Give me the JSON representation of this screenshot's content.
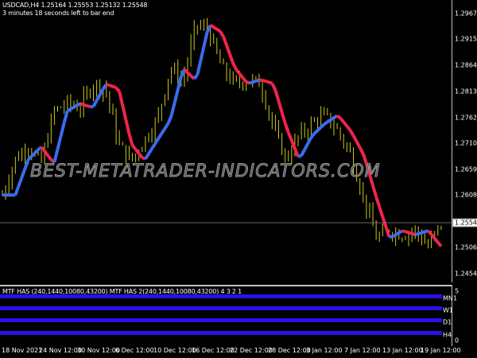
{
  "header": {
    "symbol_line": "USDCAD,H4  1.25164 1.25553 1.25132 1.25548",
    "timer": "3 minutes 18 seconds left to bar end"
  },
  "price_axis": [
    "1.29670",
    "1.29150",
    "1.28640",
    "1.28130",
    "1.27620",
    "1.27100",
    "1.26590",
    "1.26080",
    "1.25060",
    "1.24540"
  ],
  "current_price": "1.25548",
  "watermark": "BEST-METATRADER-INDICATORS.COM",
  "indicator": {
    "title": "MTF HAS (240,1440,10080,43200)  MTF HAS 2(240,1440,10080,43200) 4 3 2 1",
    "scale_max": "5",
    "scale_min": "0",
    "timeframes": [
      "MN1",
      "W1",
      "D1",
      "H4"
    ],
    "bar_color": "#2a10e8"
  },
  "date_axis": [
    "18 Nov 2021",
    "24 Nov 12:00",
    "30 Nov 12:00",
    "6 Dec 12:00",
    "10 Dec 12:00",
    "16 Dec 12:00",
    "22 Dec 12:00",
    "28 Dec 12:00",
    "3 Jan 12:00",
    "7 Jan 12:00",
    "13 Jan 12:00",
    "19 Jan 12:00"
  ],
  "colors": {
    "bars": "#c8c81a",
    "has_up": "#3a6cf0",
    "has_down": "#f0244a"
  },
  "chart_data": {
    "type": "line",
    "ylim": [
      1.2434,
      1.299
    ],
    "close_path": [
      1.261,
      1.268,
      1.2705,
      1.2672,
      1.2775,
      1.279,
      1.2782,
      1.2828,
      1.282,
      1.271,
      1.2678,
      1.2718,
      1.2757,
      1.2859,
      1.2835,
      1.2946,
      1.293,
      1.286,
      1.2829,
      1.2837,
      1.2829,
      1.2743,
      1.268,
      1.2727,
      1.2751,
      1.2767,
      1.2736,
      1.2689,
      1.2603,
      1.2525,
      1.254,
      1.2532,
      1.254,
      1.2509,
      1.2555
    ]
  }
}
